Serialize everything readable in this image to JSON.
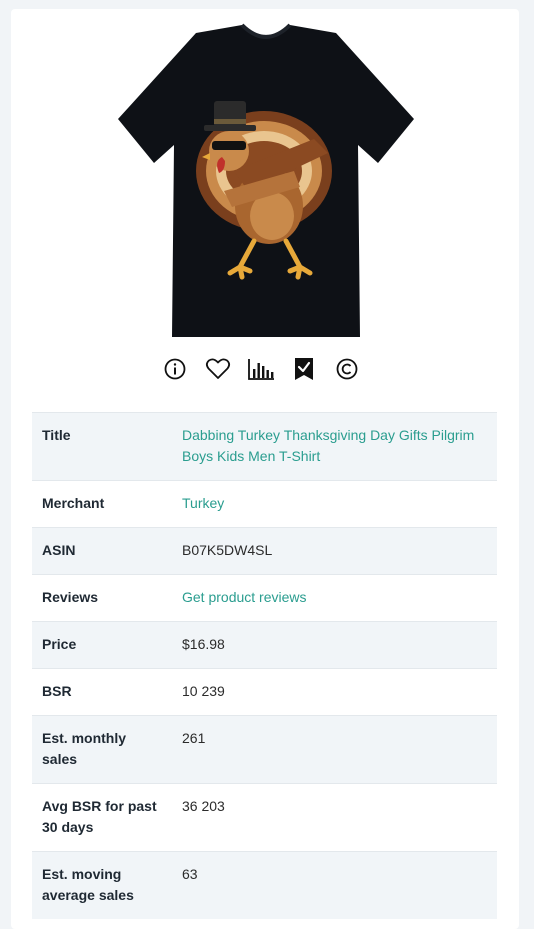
{
  "product": {
    "image_icon": "t-shirt-turkey-image"
  },
  "actions": [
    {
      "name": "info-icon"
    },
    {
      "name": "heart-icon"
    },
    {
      "name": "bar-chart-icon"
    },
    {
      "name": "bookmark-check-icon"
    },
    {
      "name": "copyright-icon"
    }
  ],
  "details": {
    "rows": [
      {
        "label": "Title",
        "value": "Dabbing Turkey Thanksgiving Day Gifts Pilgrim Boys Kids Men T-Shirt",
        "link": true
      },
      {
        "label": "Merchant",
        "value": "Turkey",
        "link": true
      },
      {
        "label": "ASIN",
        "value": "B07K5DW4SL",
        "link": false
      },
      {
        "label": "Reviews",
        "value": "Get product reviews",
        "link": true
      },
      {
        "label": "Price",
        "value": "$16.98",
        "link": false
      },
      {
        "label": "BSR",
        "value": "10 239",
        "link": false
      },
      {
        "label": "Est. monthly sales",
        "value": "261",
        "link": false
      },
      {
        "label": "Avg BSR for past 30 days",
        "value": "36 203",
        "link": false
      },
      {
        "label": "Est. moving average sales",
        "value": "63",
        "link": false
      }
    ]
  },
  "colors": {
    "link": "#2a9d8f",
    "row_alt": "#f1f5f8",
    "page_bg": "#f1f4f7"
  }
}
